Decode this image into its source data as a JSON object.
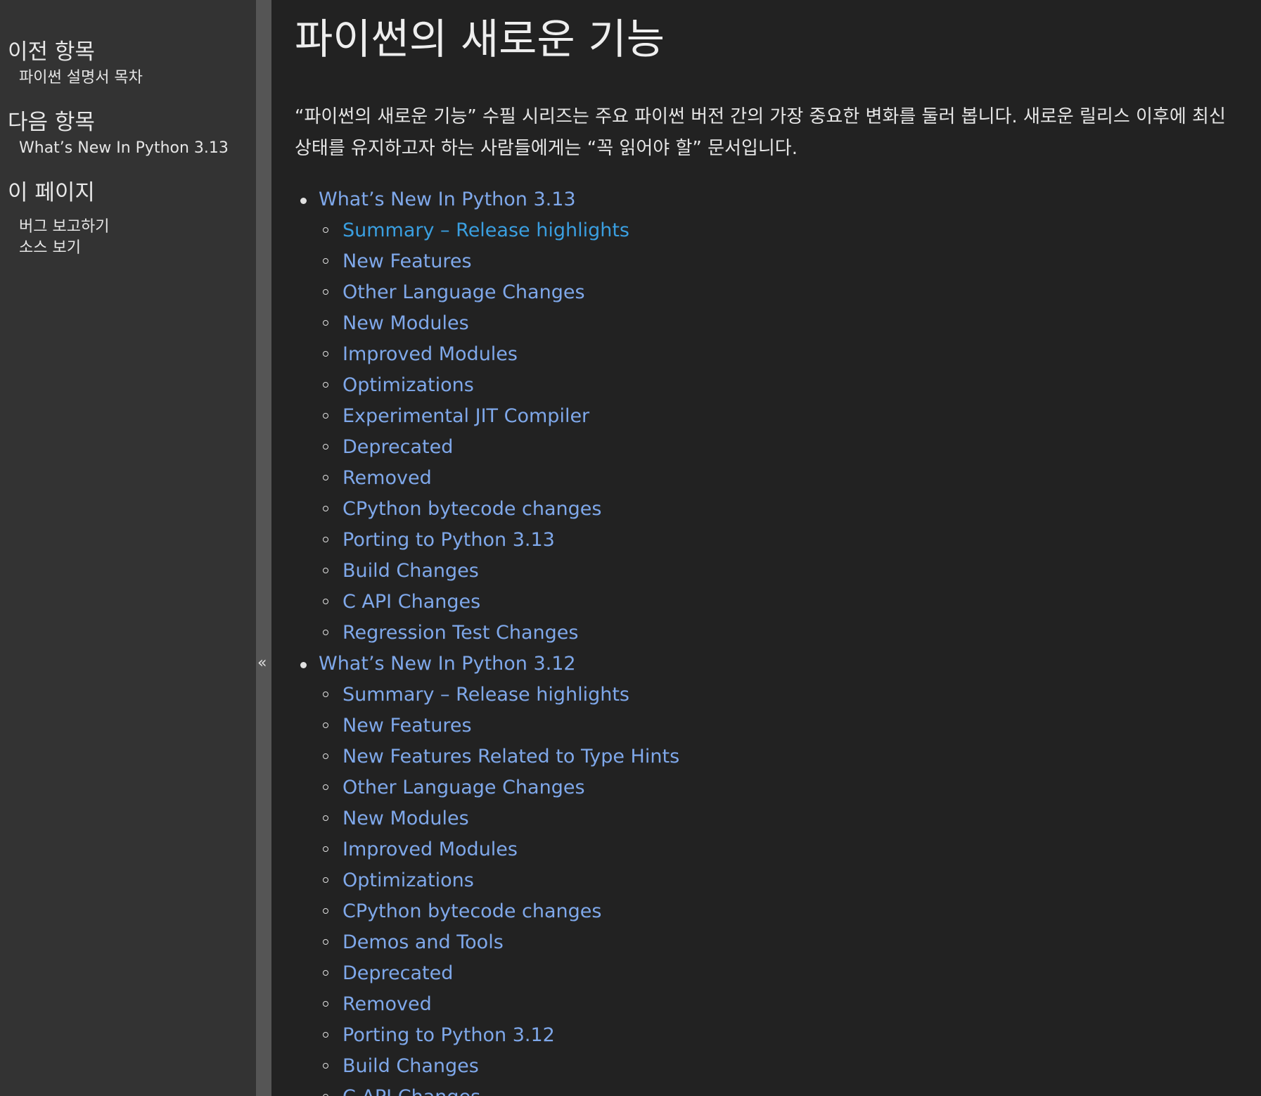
{
  "sidebar": {
    "prev": {
      "heading": "이전 항목",
      "link": "파이썬 설명서 목차"
    },
    "next": {
      "heading": "다음 항목",
      "link": "What’s New In Python 3.13"
    },
    "this_page": {
      "heading": "이 페이지",
      "links": [
        "버그 보고하기",
        "소스 보기"
      ]
    },
    "collapse_label": "«"
  },
  "main": {
    "title": "파이썬의 새로운 기능",
    "intro": "“파이썬의 새로운 기능” 수필 시리즈는 주요 파이썬 버전 간의 가장 중요한 변화를 둘러 봅니다. 새로운 릴리스 이후에 최신 상태를 유지하고자 하는 사람들에게는 “꼭 읽어야 할” 문서입니다.",
    "toc": [
      {
        "label": "What’s New In Python 3.13",
        "items": [
          "Summary – Release highlights",
          "New Features",
          "Other Language Changes",
          "New Modules",
          "Improved Modules",
          "Optimizations",
          "Experimental JIT Compiler",
          "Deprecated",
          "Removed",
          "CPython bytecode changes",
          "Porting to Python 3.13",
          "Build Changes",
          "C API Changes",
          "Regression Test Changes"
        ]
      },
      {
        "label": "What’s New In Python 3.12",
        "items": [
          "Summary – Release highlights",
          "New Features",
          "New Features Related to Type Hints",
          "Other Language Changes",
          "New Modules",
          "Improved Modules",
          "Optimizations",
          "CPython bytecode changes",
          "Demos and Tools",
          "Deprecated",
          "Removed",
          "Porting to Python 3.12",
          "Build Changes",
          "C API Changes"
        ]
      }
    ]
  },
  "colors": {
    "background": "#222222",
    "sidebar": "#333333",
    "link": "#7fa8ea",
    "link_hover": "#3a9fe0"
  }
}
